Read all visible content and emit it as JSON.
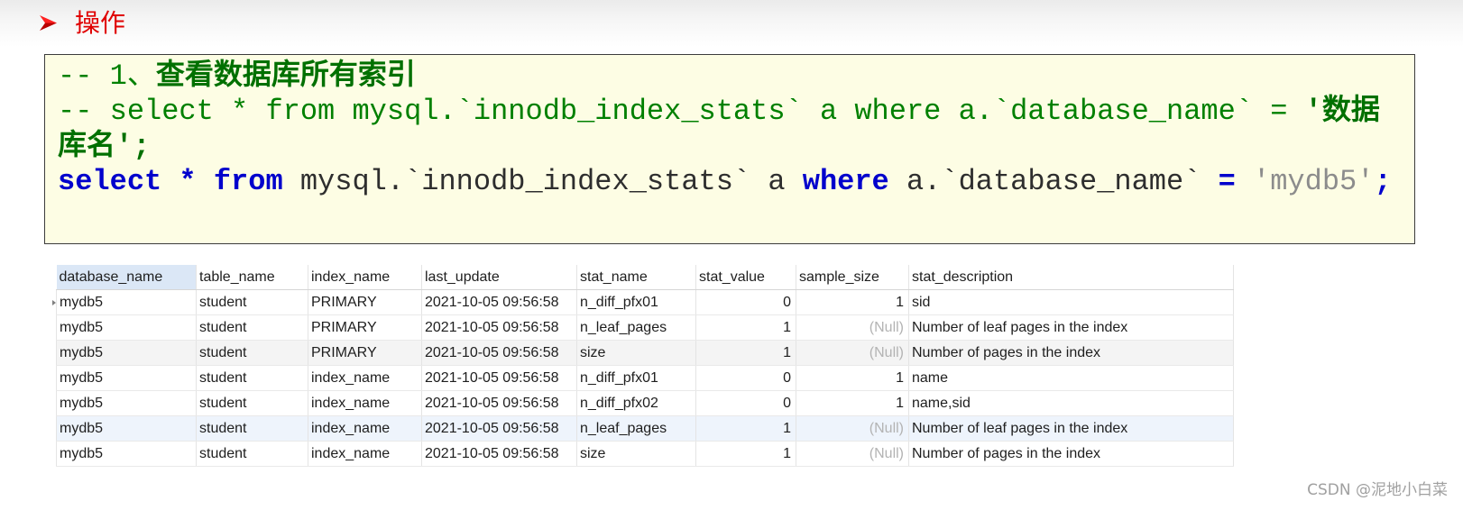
{
  "section": {
    "bullet_icon": "arrow-bullet-icon",
    "title": "操作",
    "color": "#e00000"
  },
  "code_box": {
    "background": "#fdfde4",
    "syntax_colors": {
      "comment": "#008000",
      "comment_strong": "#007000",
      "keyword": "#0000cc",
      "plain": "#2e2e2e",
      "string": "#8c8c8c"
    },
    "lines": [
      [
        {
          "comment": "-- 1、"
        },
        {
          "comment_strong": "查看数据库所有索引"
        }
      ],
      [
        {
          "comment": "-- select * from mysql.`innodb_index_stats` a where a.`database_name` = "
        },
        {
          "comment_strong": "'数据"
        }
      ],
      [
        {
          "comment_strong": "库名';"
        }
      ],
      [
        {
          "keyword": "select "
        },
        {
          "keyword": "* "
        },
        {
          "keyword": "from"
        },
        {
          "plain": " mysql.`innodb_index_stats` a "
        },
        {
          "keyword": "where"
        },
        {
          "plain": " a.`database_name` "
        },
        {
          "keyword": "= "
        },
        {
          "string": "'mydb5'"
        },
        {
          "keyword": ";"
        }
      ]
    ]
  },
  "result_grid": {
    "null_label": "(Null)",
    "columns": [
      "database_name",
      "table_name",
      "index_name",
      "last_update",
      "stat_name",
      "stat_value",
      "sample_size",
      "stat_description"
    ],
    "rows": [
      [
        "mydb5",
        "student",
        "PRIMARY",
        "2021-10-05 09:56:58",
        "n_diff_pfx01",
        0,
        1,
        "sid"
      ],
      [
        "mydb5",
        "student",
        "PRIMARY",
        "2021-10-05 09:56:58",
        "n_leaf_pages",
        1,
        null,
        "Number of leaf pages in the index"
      ],
      [
        "mydb5",
        "student",
        "PRIMARY",
        "2021-10-05 09:56:58",
        "size",
        1,
        null,
        "Number of pages in the index"
      ],
      [
        "mydb5",
        "student",
        "index_name",
        "2021-10-05 09:56:58",
        "n_diff_pfx01",
        0,
        1,
        "name"
      ],
      [
        "mydb5",
        "student",
        "index_name",
        "2021-10-05 09:56:58",
        "n_diff_pfx02",
        0,
        1,
        "name,sid"
      ],
      [
        "mydb5",
        "student",
        "index_name",
        "2021-10-05 09:56:58",
        "n_leaf_pages",
        1,
        null,
        "Number of leaf pages in the index"
      ],
      [
        "mydb5",
        "student",
        "index_name",
        "2021-10-05 09:56:58",
        "size",
        1,
        null,
        "Number of pages in the index"
      ]
    ]
  },
  "watermark": {
    "text": "CSDN @泥地小白菜"
  }
}
